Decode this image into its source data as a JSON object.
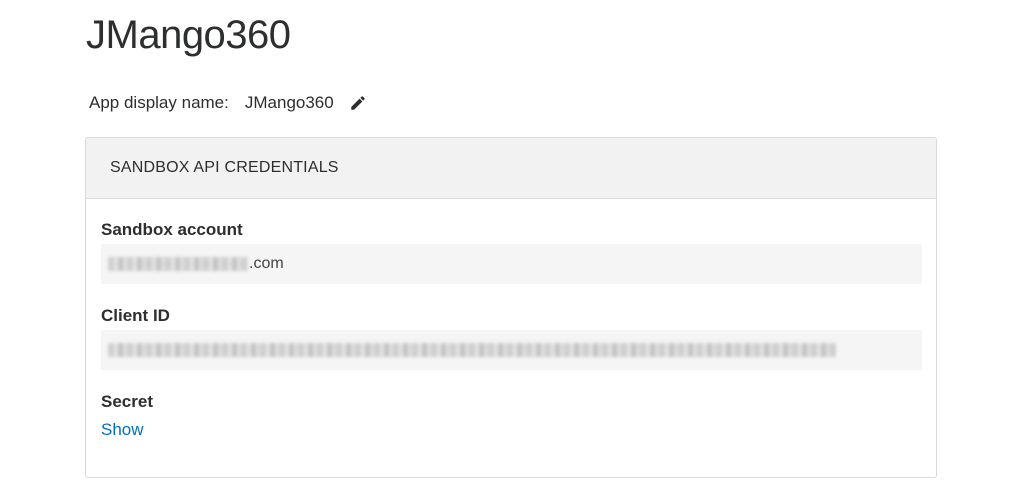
{
  "app": {
    "title": "JMango360",
    "display_name_label": "App display name:",
    "display_name_value": "JMango360"
  },
  "credentials": {
    "header": "SANDBOX API CREDENTIALS",
    "sandbox_account": {
      "label": "Sandbox account",
      "value_visible_suffix": ".com"
    },
    "client_id": {
      "label": "Client ID"
    },
    "secret": {
      "label": "Secret",
      "show_link": "Show"
    }
  },
  "colors": {
    "link": "#0070ba",
    "header_bg": "#f2f2f2",
    "field_bg": "#f5f5f5",
    "border": "#d9d9d9"
  },
  "icons": {
    "edit": "pencil-icon"
  }
}
